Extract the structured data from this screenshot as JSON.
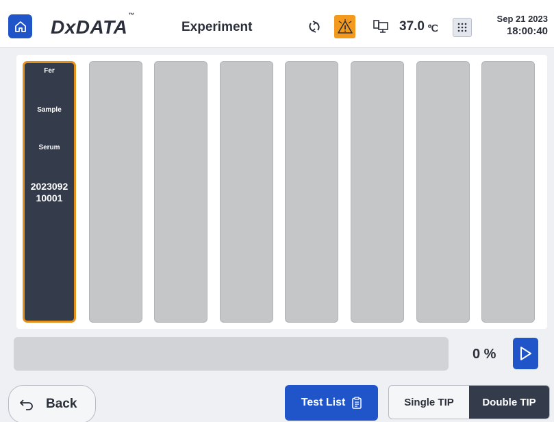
{
  "header": {
    "logo": "DxDATA",
    "logo_tm": "™",
    "title": "Experiment",
    "temperature": "37.0",
    "temperature_unit": "℃",
    "date": "Sep 21 2023",
    "time": "18:00:40",
    "icons": [
      "home-icon",
      "sync-icon",
      "alarm-icon",
      "computer-icon",
      "keypad-icon"
    ],
    "alarm_color": "#f39a1e"
  },
  "slots": [
    {
      "test": "Fer",
      "type": "Sample",
      "specimen": "Serum",
      "id_line1": "2023092",
      "id_line2": "10001",
      "active": true
    },
    {
      "active": false
    },
    {
      "active": false
    },
    {
      "active": false
    },
    {
      "active": false
    },
    {
      "active": false
    },
    {
      "active": false
    },
    {
      "active": false
    }
  ],
  "progress": {
    "value": 0,
    "label": "0 %"
  },
  "footer": {
    "back_label": "Back",
    "test_list_label": "Test List",
    "single_tip_label": "Single TIP",
    "double_tip_label": "Double TIP",
    "selected_tip": "Double TIP"
  },
  "colors": {
    "accent": "#1f55c9",
    "dark": "#343c4b",
    "highlight": "#e4901d",
    "slot_empty": "#c5c6c8"
  }
}
